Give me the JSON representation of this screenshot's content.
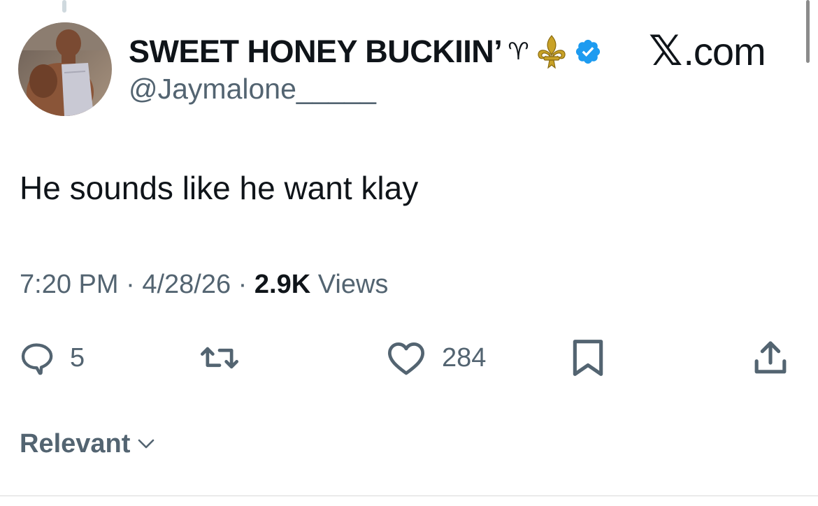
{
  "tweet": {
    "display_name": "SWEET HONEY BUCKIIN’",
    "name_emojis": {
      "aries": "♈",
      "fleur": "fleur-de-lis-icon",
      "verified": "verified-badge-icon"
    },
    "handle": "@Jaymalone_____",
    "text": "He sounds like he want klay",
    "time": "7:20 PM",
    "separator": "·",
    "date": "4/28/26",
    "views_count": "2.9K",
    "views_label": "Views"
  },
  "brand": {
    "x_mark": "𝕏",
    "domain": ".com"
  },
  "actions": {
    "reply_count": "5",
    "retweet_count": "",
    "like_count": "284"
  },
  "sort": {
    "label": "Relevant"
  },
  "colors": {
    "text_primary": "#0f1419",
    "text_secondary": "#536471",
    "verified_blue": "#1d9bf0",
    "fleur_gold": "#c9a227"
  }
}
